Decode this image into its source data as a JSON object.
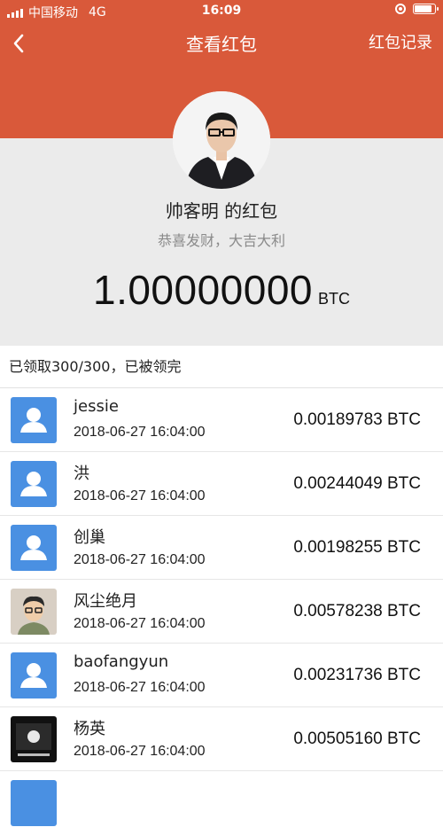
{
  "status_bar": {
    "carrier": "中国移动",
    "network": "4G",
    "time": "16:09"
  },
  "nav": {
    "back_icon": "chevron-left-icon",
    "title": "查看红包",
    "record_label": "红包记录"
  },
  "packet": {
    "sender_title": "帅客明 的红包",
    "greeting": "恭喜发财，大吉大利",
    "amount": "1.00000000",
    "unit": "BTC"
  },
  "summary": "已领取300/300，已被领完",
  "receivers": [
    {
      "name": "jessie",
      "time": "2018-06-27 16:04:00",
      "amount": "0.00189783 BTC",
      "avatar": "default-person"
    },
    {
      "name": "洪",
      "time": "2018-06-27 16:04:00",
      "amount": "0.00244049 BTC",
      "avatar": "default-person"
    },
    {
      "name": "创巢",
      "time": "2018-06-27 16:04:00",
      "amount": "0.00198255 BTC",
      "avatar": "default-person"
    },
    {
      "name": "风尘绝月",
      "time": "2018-06-27 16:04:00",
      "amount": "0.00578238 BTC",
      "avatar": "cartoon-face"
    },
    {
      "name": "baofangyun",
      "time": "2018-06-27 16:04:00",
      "amount": "0.00231736 BTC",
      "avatar": "default-person"
    },
    {
      "name": "杨英",
      "time": "2018-06-27 16:04:00",
      "amount": "0.00505160 BTC",
      "avatar": "dark-photo"
    }
  ],
  "colors": {
    "accent": "#d9593a",
    "default_avatar": "#4a90e2",
    "background": "#ebebeb"
  }
}
